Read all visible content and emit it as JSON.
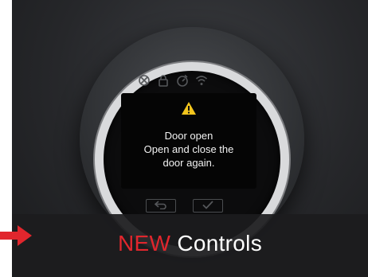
{
  "device": {
    "status_icons": [
      "no-connection-icon",
      "lock-icon",
      "timer-icon",
      "wifi-icon"
    ],
    "screen": {
      "alert_icon": "warning-triangle-icon",
      "message_line1": "Door open",
      "message_line2": "Open and close the",
      "message_line3": "door again."
    },
    "buttons": {
      "back_icon": "back-arrow-icon",
      "confirm_icon": "checkmark-icon"
    }
  },
  "banner": {
    "highlight": "NEW",
    "title": "Controls",
    "arrow_icon": "right-arrow-icon"
  },
  "colors": {
    "accent_red": "#e1262d",
    "warning_yellow": "#f3c51d"
  }
}
